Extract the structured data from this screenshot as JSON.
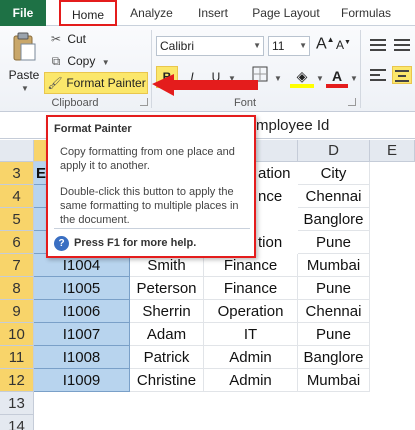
{
  "tabs": {
    "file": "File",
    "home": "Home",
    "analyze": "Analyze",
    "insert": "Insert",
    "page_layout": "Page Layout",
    "formulas": "Formulas"
  },
  "clipboard": {
    "paste": "Paste",
    "cut": "Cut",
    "copy": "Copy",
    "format_painter": "Format Painter",
    "group_label": "Clipboard"
  },
  "font": {
    "name": "Calibri",
    "size": "11",
    "bold": "B",
    "italic": "I",
    "underline": "U",
    "grow": "A",
    "shrink": "A",
    "font_color": "A",
    "group_label": "Font"
  },
  "formula_bar": {
    "value_partial": "mployee Id"
  },
  "tooltip": {
    "title": "Format Painter",
    "p1": "Copy formatting from one place and apply it to another.",
    "p2": "Double-click this button to apply the same formatting to multiple places in the document.",
    "help": "Press F1 for more help.",
    "help_icon_text": "?"
  },
  "columns": {
    "d": "D",
    "e": "E"
  },
  "rows": [
    "3",
    "4",
    "5",
    "6",
    "7",
    "8",
    "9",
    "10",
    "11",
    "12",
    "13",
    "14"
  ],
  "peek": {
    "a3": "E",
    "c3": "ation",
    "c4": "nce",
    "c6": "tion",
    "d3": "City",
    "d4": "Chennai",
    "d5": "Banglore",
    "d6": "Pune"
  },
  "table_rows": [
    {
      "id": "I1004",
      "name": "Smith",
      "dept": "Finance",
      "city": "Mumbai"
    },
    {
      "id": "I1005",
      "name": "Peterson",
      "dept": "Finance",
      "city": "Pune"
    },
    {
      "id": "I1006",
      "name": "Sherrin",
      "dept": "Operation",
      "city": "Chennai"
    },
    {
      "id": "I1007",
      "name": "Adam",
      "dept": "IT",
      "city": "Pune"
    },
    {
      "id": "I1008",
      "name": "Patrick",
      "dept": "Admin",
      "city": "Banglore"
    },
    {
      "id": "I1009",
      "name": "Christine",
      "dept": "Admin",
      "city": "Mumbai"
    }
  ],
  "colors": {
    "excel_green": "#1e7145",
    "highlight_red": "#e41c1c",
    "active_yellow": "#fbe76b",
    "selection_blue": "#b8d4ee"
  }
}
